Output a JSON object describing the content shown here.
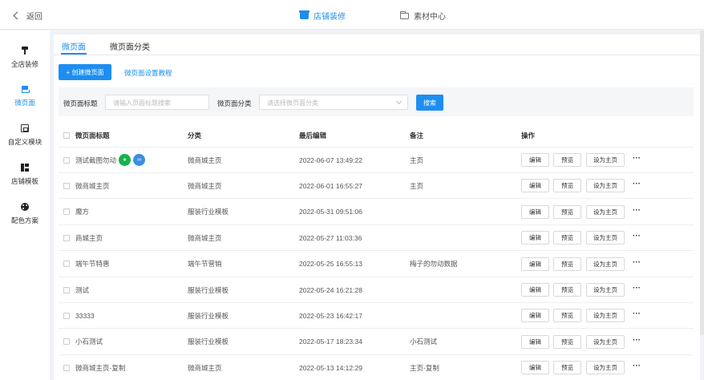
{
  "topbar": {
    "back_label": "返回",
    "tabs": [
      {
        "label": "店铺装修",
        "icon": "store-icon",
        "active": true
      },
      {
        "label": "素材中心",
        "icon": "folder-icon",
        "active": false
      }
    ]
  },
  "sidebar": {
    "items": [
      {
        "label": "全店装修",
        "icon": "brush-icon",
        "active": false
      },
      {
        "label": "微页面",
        "icon": "layers-icon",
        "active": true
      },
      {
        "label": "自定义模块",
        "icon": "module-icon",
        "active": false
      },
      {
        "label": "店铺模板",
        "icon": "template-icon",
        "active": false
      },
      {
        "label": "配色方案",
        "icon": "palette-icon",
        "active": false
      }
    ]
  },
  "subtabs": [
    {
      "label": "微页面",
      "active": true
    },
    {
      "label": "微页面分类",
      "active": false
    }
  ],
  "actions": {
    "create_label": "+ 创建微页面",
    "tutorial_link": "微页面设置教程"
  },
  "filter": {
    "title_label": "微页面标题",
    "title_placeholder": "请输入页面标题搜索",
    "category_label": "微页面分类",
    "category_placeholder": "请选择微页面分类",
    "search_label": "搜索"
  },
  "table": {
    "columns": [
      "微页面标题",
      "分类",
      "最后编辑",
      "备注",
      "操作"
    ],
    "op_labels": {
      "edit": "编辑",
      "preview": "预览",
      "set_home": "设为主页",
      "more": "···"
    },
    "rows": [
      {
        "title": "测试截图勿动",
        "category": "微商城主页",
        "edited": "2022-06-07 13:49:22",
        "note": "主页",
        "badges": true
      },
      {
        "title": "微商城主页",
        "category": "微商城主页",
        "edited": "2022-06-01 16:55:27",
        "note": "主页"
      },
      {
        "title": "魔方",
        "category": "服装行业模板",
        "edited": "2022-05-31 09:51:06",
        "note": ""
      },
      {
        "title": "商城主页",
        "category": "微商城主页",
        "edited": "2022-05-27 11:03:36",
        "note": ""
      },
      {
        "title": "端午节特惠",
        "category": "端午节营销",
        "edited": "2022-05-25 16:55:13",
        "note": "梅子的勿动数据"
      },
      {
        "title": "测试",
        "category": "服装行业模板",
        "edited": "2022-05-24 16:21:28",
        "note": ""
      },
      {
        "title": "33333",
        "category": "服装行业模板",
        "edited": "2022-05-23 16:42:17",
        "note": ""
      },
      {
        "title": "小石测试",
        "category": "服装行业模板",
        "edited": "2022-05-17 18:23:34",
        "note": "小石测试"
      },
      {
        "title": "微商城主页-复制",
        "category": "微商城主页",
        "edited": "2022-05-13 14:12:29",
        "note": "主页-复制"
      }
    ]
  }
}
